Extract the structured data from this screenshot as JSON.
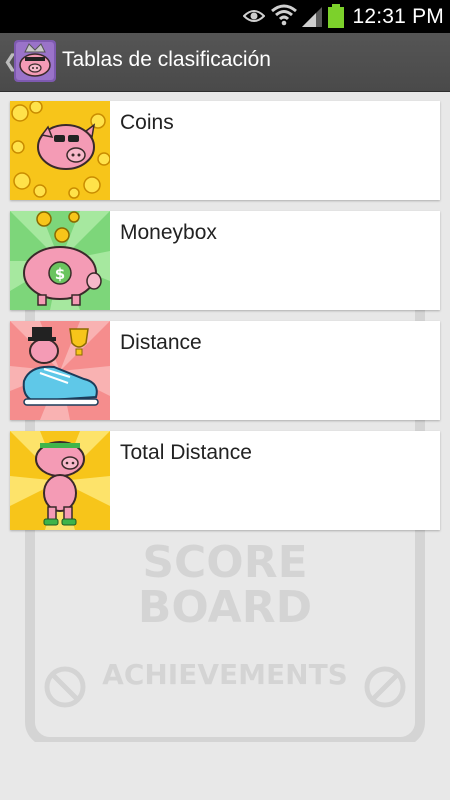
{
  "status_bar": {
    "time": "12:31 PM",
    "icons": [
      "eye-icon",
      "wifi-icon",
      "signal-icon",
      "battery-icon"
    ]
  },
  "action_bar": {
    "title": "Tablas de clasificación",
    "up_icon": "chevron-left-icon",
    "app_icon": "pig-app-icon"
  },
  "leaderboards": [
    {
      "label": "Coins",
      "icon": "coins-pig-icon"
    },
    {
      "label": "Moneybox",
      "icon": "piggy-bank-icon"
    },
    {
      "label": "Distance",
      "icon": "sneaker-pig-icon"
    },
    {
      "label": "Total Distance",
      "icon": "athlete-pig-icon"
    }
  ],
  "background": {
    "text_lines": [
      "SCORE",
      "BOARD",
      "ACHIEVEMENTS"
    ]
  },
  "colors": {
    "status_bar": "#000000",
    "action_bar": "#4e4e4e",
    "content_bg": "#e8e8e8",
    "card_bg": "#ffffff",
    "pig_pink": "#f49bb5",
    "battery_green": "#7cd12b"
  }
}
